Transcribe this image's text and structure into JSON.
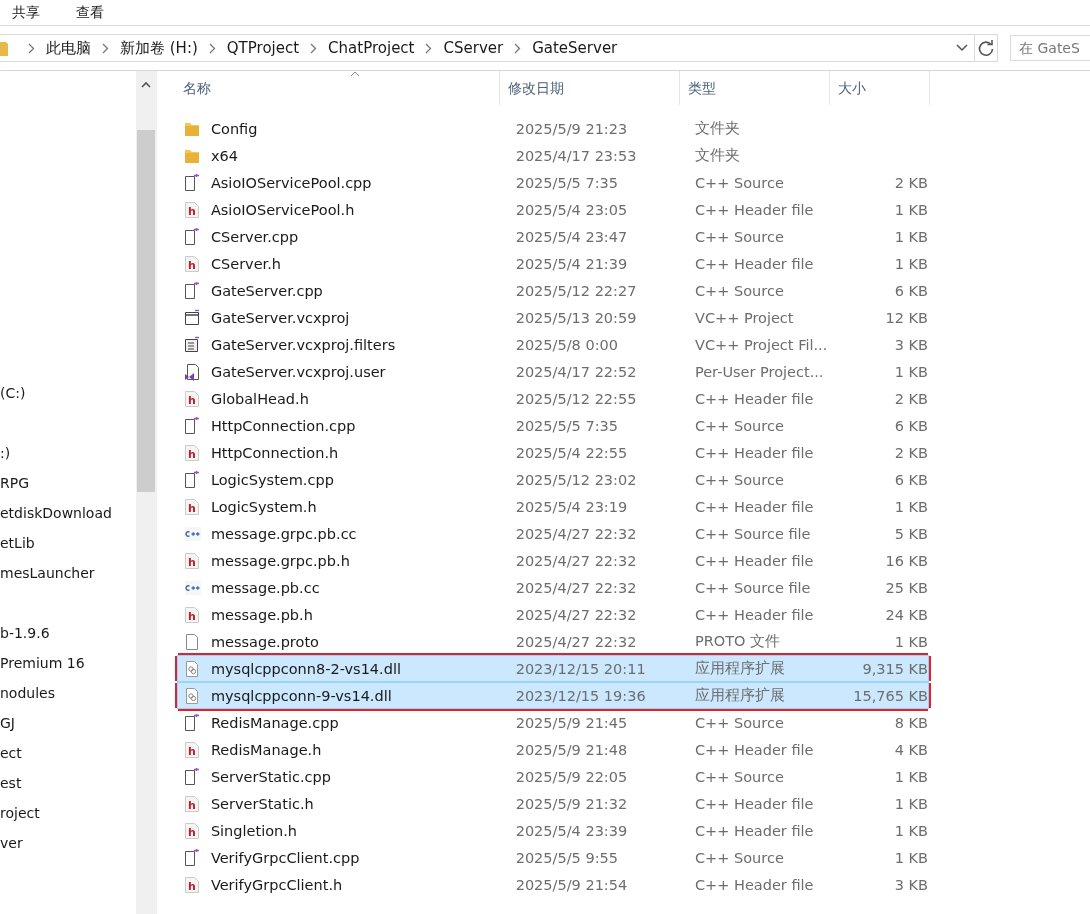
{
  "ribbon_tabs": [
    {
      "label": "共享"
    },
    {
      "label": "查看"
    }
  ],
  "address_bar": {
    "breadcrumbs": [
      "此电脑",
      "新加卷 (H:)",
      "QTProject",
      "ChatProject",
      "CServer",
      "GateServer"
    ]
  },
  "search": {
    "placeholder": "在 GateS"
  },
  "sidebar": {
    "groups": [
      {
        "items": [
          {
            "label": "(C:)"
          }
        ]
      },
      {
        "items": [
          {
            "label": ":)"
          },
          {
            "label": "RPG"
          },
          {
            "label": "etdiskDownload"
          },
          {
            "label": "etLib"
          },
          {
            "label": "mesLauncher"
          }
        ]
      },
      {
        "items": [
          {
            "label": "b-1.9.6"
          },
          {
            "label": " Premium 16"
          },
          {
            "label": "nodules"
          },
          {
            "label": "GJ"
          },
          {
            "label": "ect"
          },
          {
            "label": "est"
          },
          {
            "label": "roject"
          },
          {
            "label": "ver"
          }
        ]
      }
    ]
  },
  "table": {
    "columns": [
      "名称",
      "修改日期",
      "类型",
      "大小"
    ],
    "rows": [
      {
        "kind": "folder",
        "name": "Config",
        "date": "2025/5/9 21:23",
        "type": "文件夹",
        "selected": false,
        "outlined": false
      },
      {
        "kind": "folder",
        "name": "x64",
        "date": "2025/4/17 23:53",
        "type": "文件夹",
        "selected": false,
        "outlined": false
      },
      {
        "kind": "cpp",
        "name": "AsioIOServicePool.cpp",
        "date": "2025/5/5 7:35",
        "type": "C++ Source",
        "size": "2 KB",
        "selected": false,
        "outlined": false
      },
      {
        "kind": "h",
        "name": "AsioIOServicePool.h",
        "date": "2025/5/4 23:05",
        "type": "C++ Header file",
        "size": "1 KB",
        "selected": false,
        "outlined": false
      },
      {
        "kind": "cpp",
        "name": "CServer.cpp",
        "date": "2025/5/4 23:47",
        "type": "C++ Source",
        "size": "1 KB",
        "selected": false,
        "outlined": false
      },
      {
        "kind": "h",
        "name": "CServer.h",
        "date": "2025/5/4 21:39",
        "type": "C++ Header file",
        "size": "1 KB",
        "selected": false,
        "outlined": false
      },
      {
        "kind": "cpp",
        "name": "GateServer.cpp",
        "date": "2025/5/12 22:27",
        "type": "C++ Source",
        "size": "6 KB",
        "selected": false,
        "outlined": false
      },
      {
        "kind": "vcxproj",
        "name": "GateServer.vcxproj",
        "date": "2025/5/13 20:59",
        "type": "VC++ Project",
        "size": "12 KB",
        "selected": false,
        "outlined": false
      },
      {
        "kind": "filters",
        "name": "GateServer.vcxproj.filters",
        "date": "2025/5/8 0:00",
        "type": "VC++ Project Fil...",
        "size": "3 KB",
        "selected": false,
        "outlined": false
      },
      {
        "kind": "user",
        "name": "GateServer.vcxproj.user",
        "date": "2025/4/17 22:52",
        "type": "Per-User Project...",
        "size": "1 KB",
        "selected": false,
        "outlined": false
      },
      {
        "kind": "h",
        "name": "GlobalHead.h",
        "date": "2025/5/12 22:55",
        "type": "C++ Header file",
        "size": "2 KB",
        "selected": false,
        "outlined": false
      },
      {
        "kind": "cpp",
        "name": "HttpConnection.cpp",
        "date": "2025/5/5 7:35",
        "type": "C++ Source",
        "size": "6 KB",
        "selected": false,
        "outlined": false
      },
      {
        "kind": "h",
        "name": "HttpConnection.h",
        "date": "2025/5/4 22:55",
        "type": "C++ Header file",
        "size": "2 KB",
        "selected": false,
        "outlined": false
      },
      {
        "kind": "cpp",
        "name": "LogicSystem.cpp",
        "date": "2025/5/12 23:02",
        "type": "C++ Source",
        "size": "6 KB",
        "selected": false,
        "outlined": false
      },
      {
        "kind": "h",
        "name": "LogicSystem.h",
        "date": "2025/5/4 23:19",
        "type": "C++ Header file",
        "size": "1 KB",
        "selected": false,
        "outlined": false
      },
      {
        "kind": "cc",
        "name": "message.grpc.pb.cc",
        "date": "2025/4/27 22:32",
        "type": "C++ Source file",
        "size": "5 KB",
        "selected": false,
        "outlined": false
      },
      {
        "kind": "h",
        "name": "message.grpc.pb.h",
        "date": "2025/4/27 22:32",
        "type": "C++ Header file",
        "size": "16 KB",
        "selected": false,
        "outlined": false
      },
      {
        "kind": "cc",
        "name": "message.pb.cc",
        "date": "2025/4/27 22:32",
        "type": "C++ Source file",
        "size": "25 KB",
        "selected": false,
        "outlined": false
      },
      {
        "kind": "h",
        "name": "message.pb.h",
        "date": "2025/4/27 22:32",
        "type": "C++ Header file",
        "size": "24 KB",
        "selected": false,
        "outlined": false
      },
      {
        "kind": "proto",
        "name": "message.proto",
        "date": "2025/4/27 22:32",
        "type": "PROTO 文件",
        "size": "1 KB",
        "selected": false,
        "outlined": false
      },
      {
        "kind": "dll",
        "name": "mysqlcppconn8-2-vs14.dll",
        "date": "2023/12/15 20:11",
        "type": "应用程序扩展",
        "size": "9,315 KB",
        "selected": true,
        "outlined": true
      },
      {
        "kind": "dll",
        "name": "mysqlcppconn-9-vs14.dll",
        "date": "2023/12/15 19:36",
        "type": "应用程序扩展",
        "size": "15,765 KB",
        "selected": true,
        "outlined": true
      },
      {
        "kind": "cpp",
        "name": "RedisManage.cpp",
        "date": "2025/5/9 21:45",
        "type": "C++ Source",
        "size": "8 KB",
        "selected": false,
        "outlined": false
      },
      {
        "kind": "h",
        "name": "RedisManage.h",
        "date": "2025/5/9 21:48",
        "type": "C++ Header file",
        "size": "4 KB",
        "selected": false,
        "outlined": false
      },
      {
        "kind": "cpp",
        "name": "ServerStatic.cpp",
        "date": "2025/5/9 22:05",
        "type": "C++ Source",
        "size": "1 KB",
        "selected": false,
        "outlined": false
      },
      {
        "kind": "h",
        "name": "ServerStatic.h",
        "date": "2025/5/9 21:32",
        "type": "C++ Header file",
        "size": "1 KB",
        "selected": false,
        "outlined": false
      },
      {
        "kind": "h",
        "name": "Singletion.h",
        "date": "2025/5/4 23:39",
        "type": "C++ Header file",
        "size": "1 KB",
        "selected": false,
        "outlined": false
      },
      {
        "kind": "cpp",
        "name": "VerifyGrpcClient.cpp",
        "date": "2025/5/5 9:55",
        "type": "C++ Source",
        "size": "1 KB",
        "selected": false,
        "outlined": false
      },
      {
        "kind": "h",
        "name": "VerifyGrpcClient.h",
        "date": "2025/5/9 21:54",
        "type": "C++ Header file",
        "size": "3 KB",
        "selected": false,
        "outlined": false
      }
    ]
  }
}
